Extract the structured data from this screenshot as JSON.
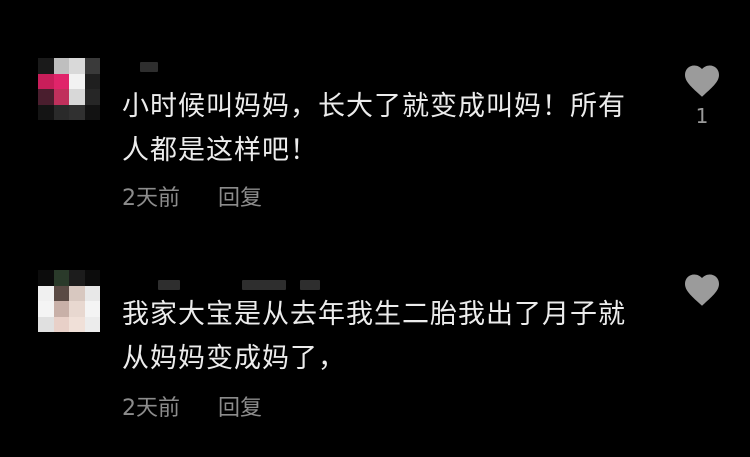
{
  "comments": [
    {
      "text": "小时候叫妈妈，长大了就变成叫妈！所有人都是这样吧！",
      "time": "2天前",
      "reply_label": "回复",
      "like_count": "1",
      "avatar_colors": [
        "#1a1a1a",
        "#bfbfbf",
        "#d9d9d9",
        "#3a3a3a",
        "#c81e5a",
        "#e0246a",
        "#f2f2f2",
        "#1f1f1f",
        "#4a1e2e",
        "#c0305c",
        "#d8d8d8",
        "#262626",
        "#141414",
        "#2a2a2a",
        "#303030",
        "#121212"
      ]
    },
    {
      "text": "我家大宝是从去年我生二胎我出了月子就从妈妈变成妈了，",
      "time": "2天前",
      "reply_label": "回复",
      "like_count": "",
      "avatar_colors": [
        "#0c0c0c",
        "#2a3a2a",
        "#1c1c1c",
        "#0c0c0c",
        "#f0f0f0",
        "#5a4a44",
        "#d8c8c0",
        "#e8e8e8",
        "#f4f4f4",
        "#c8b0a8",
        "#e8d8d0",
        "#f4f4f4",
        "#e0e0e0",
        "#e8d0c8",
        "#f0e0d8",
        "#ececec"
      ]
    }
  ],
  "icons": {
    "like": "heart-icon"
  },
  "colors": {
    "background": "#000000",
    "text": "#ececec",
    "meta": "#8c8c8c",
    "heart": "#9b9b9b"
  }
}
